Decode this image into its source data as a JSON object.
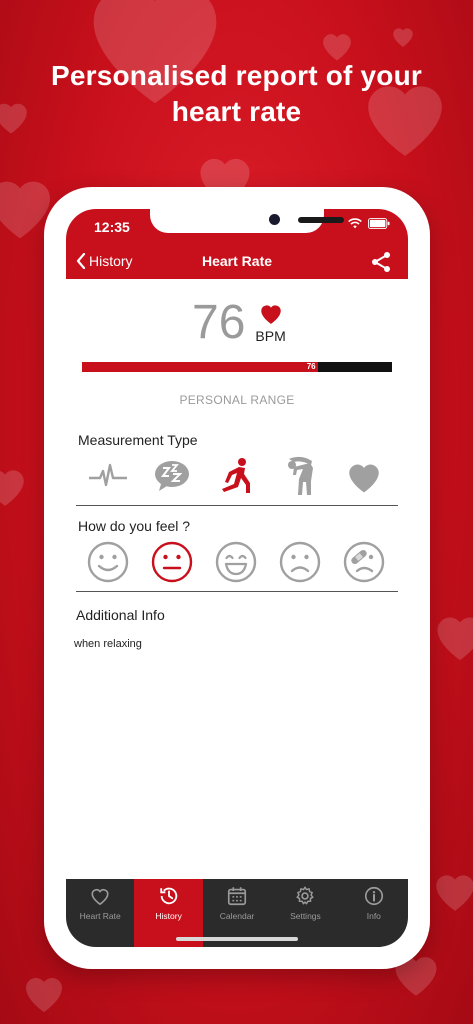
{
  "headline": {
    "line1": "Personalised report of your",
    "line2": "heart rate"
  },
  "status": {
    "time": "12:35"
  },
  "nav": {
    "back_label": "History",
    "title": "Heart Rate"
  },
  "reading": {
    "bpm": "76",
    "unit": "BPM",
    "range_fraction": 0.76,
    "range_label": "76"
  },
  "personal_range_label": "PERSONAL RANGE",
  "measurement": {
    "title": "Measurement Type",
    "icons": [
      "heartbeat-line-icon",
      "sleep-zzz-icon",
      "sprinter-start-icon",
      "bent-over-tired-icon",
      "heart-icon"
    ],
    "selected_index": 2
  },
  "feeling": {
    "title": "How do you feel ?",
    "icons": [
      "smile-face-icon",
      "neutral-face-icon",
      "grin-face-icon",
      "sad-face-icon",
      "injured-face-icon"
    ],
    "selected_index": 1
  },
  "additional": {
    "title": "Additional Info",
    "text": "when relaxing"
  },
  "tabs": [
    {
      "label": "Heart Rate",
      "icon": "heart-outline-icon"
    },
    {
      "label": "History",
      "icon": "history-clock-icon"
    },
    {
      "label": "Calendar",
      "icon": "calendar-icon"
    },
    {
      "label": "Settings",
      "icon": "gear-icon"
    },
    {
      "label": "Info",
      "icon": "info-icon"
    }
  ],
  "active_tab_index": 1,
  "colors": {
    "accent": "#c8101c",
    "icon_gray": "#a0a0a0",
    "tabbar": "#2b2b2b"
  }
}
